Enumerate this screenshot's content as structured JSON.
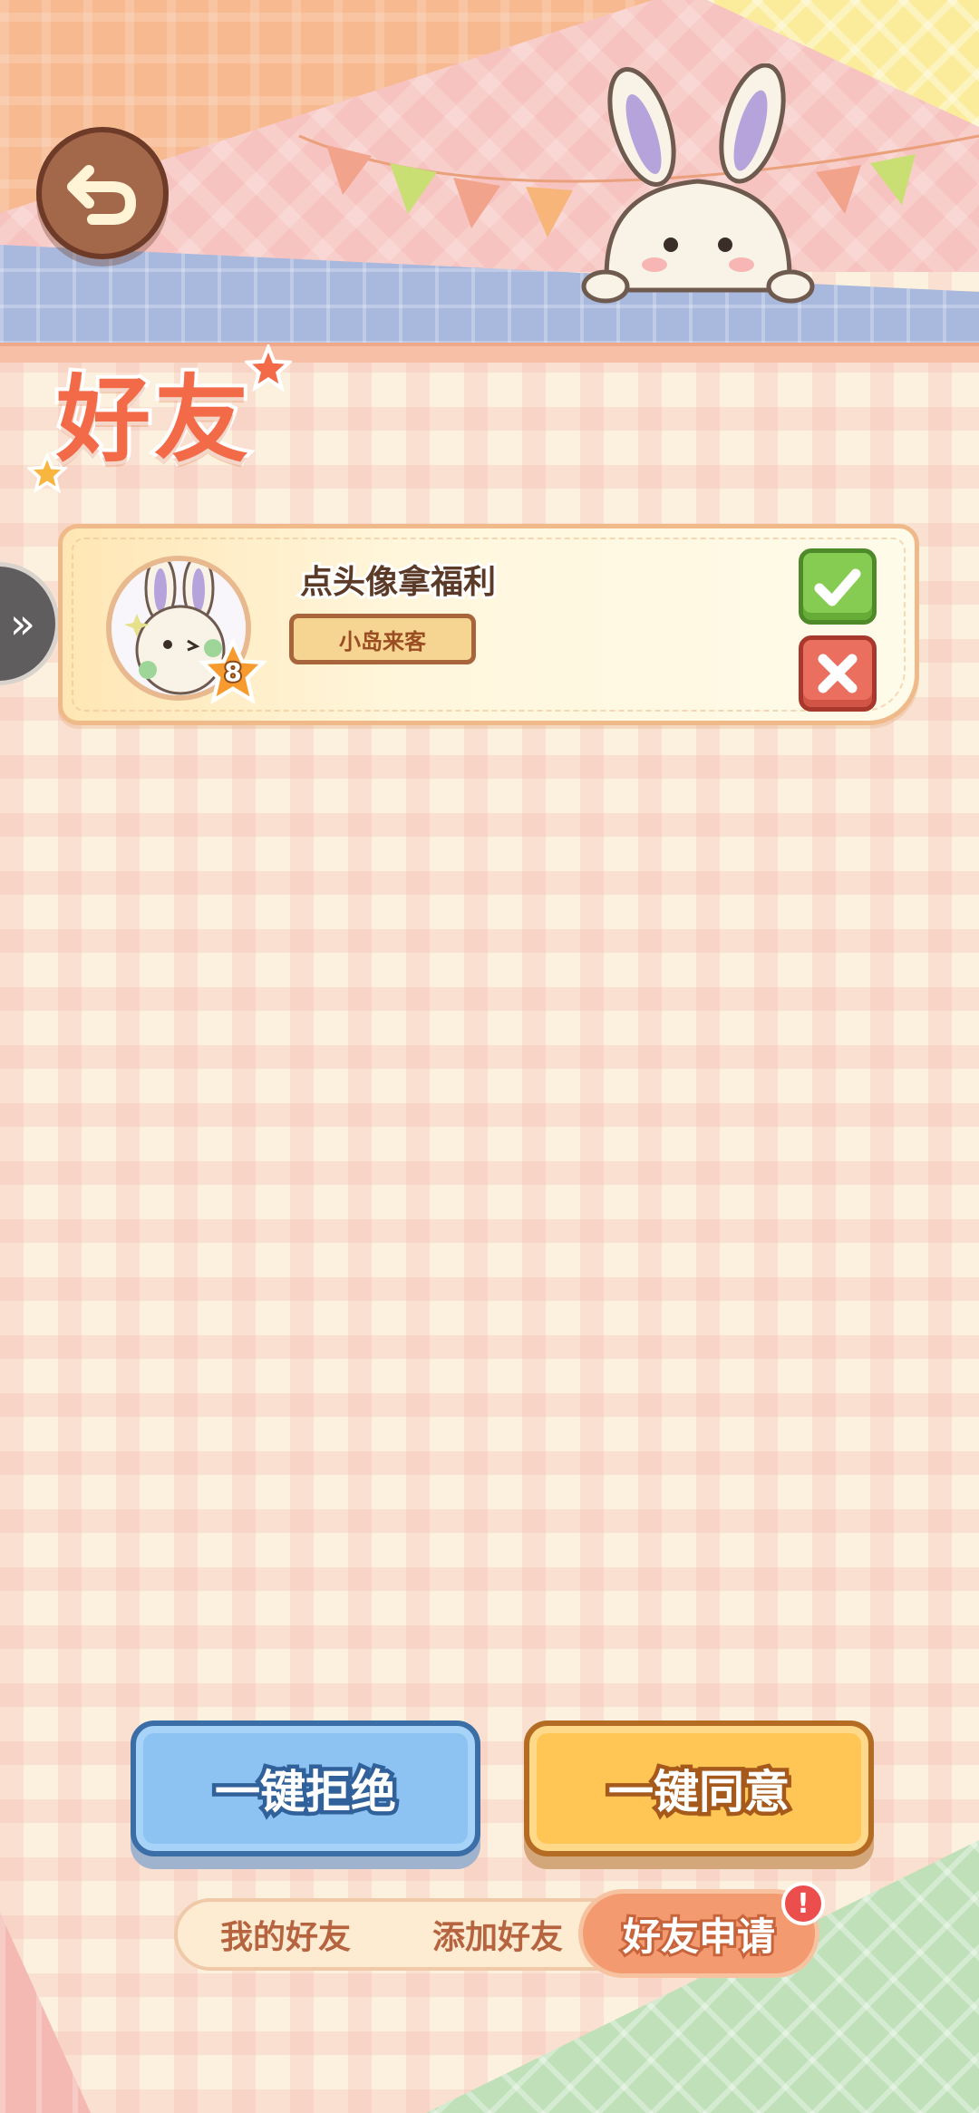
{
  "header": {
    "title": "好友",
    "back_icon": "back-arrow-icon"
  },
  "side_handle": {
    "glyph": "»",
    "icon": "double-chevron-right-icon"
  },
  "requests": [
    {
      "username": "点头像拿福利",
      "tag": "小岛来客",
      "level": "8",
      "avatar_icon": "bunny-avatar-icon",
      "accept_icon": "checkmark-icon",
      "reject_icon": "close-icon"
    }
  ],
  "actions": {
    "reject_all": "一键拒绝",
    "accept_all": "一键同意"
  },
  "tabs": {
    "my_friends": "我的好友",
    "add_friend": "添加好友",
    "friend_requests": "好友申请",
    "active": "friend_requests",
    "alert_badge": "!"
  },
  "colors": {
    "title": "#f26a47",
    "accept": "#87cc52",
    "reject": "#ea6f5f",
    "reject_all": "#8cc3f2",
    "accept_all": "#ffc656",
    "active_tab": "#f39a70"
  }
}
